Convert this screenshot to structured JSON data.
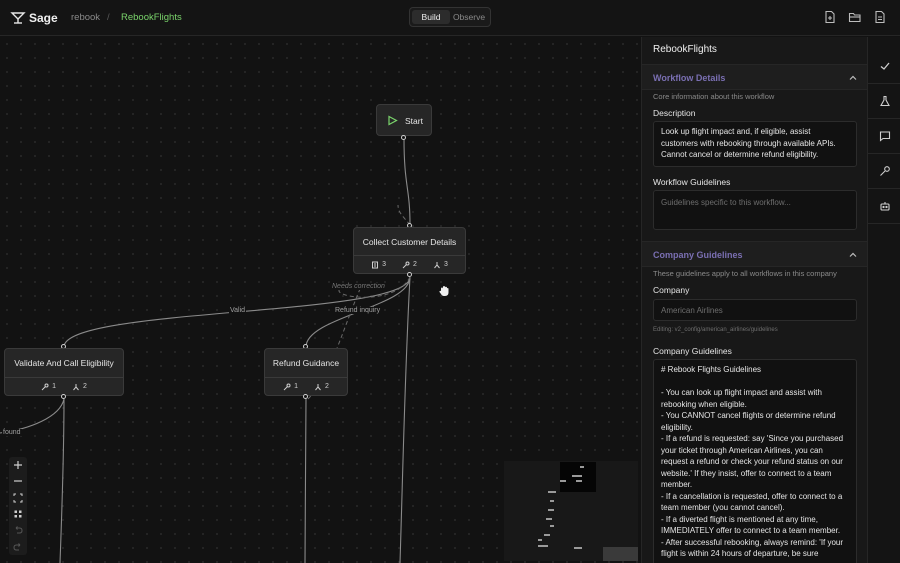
{
  "app": {
    "brand": "Sage"
  },
  "breadcrumb": {
    "project": "rebook",
    "separator": "/",
    "workflow": "RebookFlights"
  },
  "mode": {
    "build": "Build",
    "observe": "Observe",
    "active": "Build"
  },
  "toolbar": {
    "icons": [
      "file-plus-icon",
      "folder-open-icon",
      "file-export-icon"
    ]
  },
  "canvas": {
    "nodes": {
      "start": {
        "title": "Start"
      },
      "collect": {
        "title": "Collect Customer Details",
        "stats": {
          "docs": "3",
          "tools": "2",
          "branches": "3"
        }
      },
      "validate": {
        "title": "Validate And Call Eligibility",
        "stats": {
          "tools": "1",
          "branches": "2"
        }
      },
      "refund": {
        "title": "Refund Guidance",
        "stats": {
          "tools": "1",
          "branches": "2"
        }
      }
    },
    "edge_labels": {
      "needs_correction": "Needs correction",
      "valid": "Valid",
      "refund_inquiry": "Refund inquiry",
      "found": "found"
    }
  },
  "panel": {
    "title": "RebookFlights",
    "workflow_details": {
      "heading": "Workflow Details",
      "subtitle": "Core information about this workflow",
      "description_label": "Description",
      "description_value": "Look up flight impact and, if eligible, assist customers with rebooking through available APIs. Cannot cancel or determine refund eligibility.",
      "guidelines_label": "Workflow Guidelines",
      "guidelines_placeholder": "Guidelines specific to this workflow..."
    },
    "company_guidelines": {
      "heading": "Company Guidelines",
      "subtitle": "These guidelines apply to all workflows in this company",
      "company_label": "Company",
      "company_value": "American Airlines",
      "editing_hint": "Editing: v2_config/american_airlines/guidelines",
      "guidelines_label": "Company Guidelines",
      "guidelines_value": "# Rebook Flights Guidelines\n\n- You can look up flight impact and assist with rebooking when eligible.\n- You CANNOT cancel flights or determine refund eligibility.\n- If a refund is requested: say 'Since you purchased your ticket through American Airlines, you can request a refund or check your refund status on our website.' If they insist, offer to connect to a team member.\n- If a cancellation is requested, offer to connect to a team member (you cannot cancel).\n- If a diverted flight is mentioned at any time, IMMEDIATELY offer to connect to a team member.\n- After successful rebooking, always remind: 'If your flight is within 24 hours of departure, be sure"
    }
  },
  "rail": {
    "icons": [
      "check-icon",
      "flask-icon",
      "chat-icon",
      "wrench-icon",
      "robot-icon"
    ]
  }
}
